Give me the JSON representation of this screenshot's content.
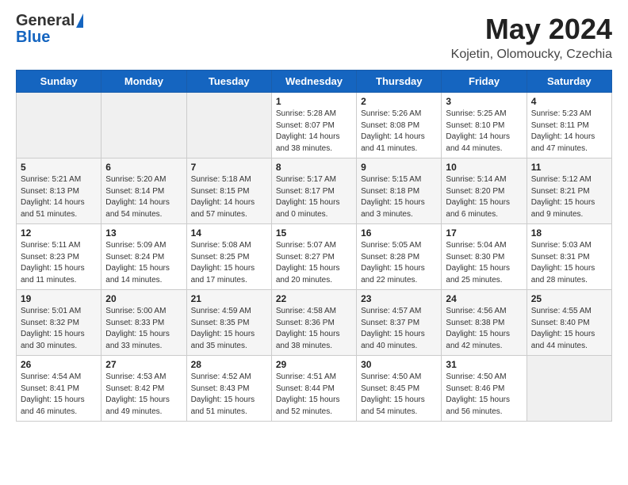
{
  "header": {
    "logo_general": "General",
    "logo_blue": "Blue",
    "month": "May 2024",
    "location": "Kojetin, Olomoucky, Czechia"
  },
  "weekdays": [
    "Sunday",
    "Monday",
    "Tuesday",
    "Wednesday",
    "Thursday",
    "Friday",
    "Saturday"
  ],
  "weeks": [
    [
      {
        "day": "",
        "info": ""
      },
      {
        "day": "",
        "info": ""
      },
      {
        "day": "",
        "info": ""
      },
      {
        "day": "1",
        "info": "Sunrise: 5:28 AM\nSunset: 8:07 PM\nDaylight: 14 hours\nand 38 minutes."
      },
      {
        "day": "2",
        "info": "Sunrise: 5:26 AM\nSunset: 8:08 PM\nDaylight: 14 hours\nand 41 minutes."
      },
      {
        "day": "3",
        "info": "Sunrise: 5:25 AM\nSunset: 8:10 PM\nDaylight: 14 hours\nand 44 minutes."
      },
      {
        "day": "4",
        "info": "Sunrise: 5:23 AM\nSunset: 8:11 PM\nDaylight: 14 hours\nand 47 minutes."
      }
    ],
    [
      {
        "day": "5",
        "info": "Sunrise: 5:21 AM\nSunset: 8:13 PM\nDaylight: 14 hours\nand 51 minutes."
      },
      {
        "day": "6",
        "info": "Sunrise: 5:20 AM\nSunset: 8:14 PM\nDaylight: 14 hours\nand 54 minutes."
      },
      {
        "day": "7",
        "info": "Sunrise: 5:18 AM\nSunset: 8:15 PM\nDaylight: 14 hours\nand 57 minutes."
      },
      {
        "day": "8",
        "info": "Sunrise: 5:17 AM\nSunset: 8:17 PM\nDaylight: 15 hours\nand 0 minutes."
      },
      {
        "day": "9",
        "info": "Sunrise: 5:15 AM\nSunset: 8:18 PM\nDaylight: 15 hours\nand 3 minutes."
      },
      {
        "day": "10",
        "info": "Sunrise: 5:14 AM\nSunset: 8:20 PM\nDaylight: 15 hours\nand 6 minutes."
      },
      {
        "day": "11",
        "info": "Sunrise: 5:12 AM\nSunset: 8:21 PM\nDaylight: 15 hours\nand 9 minutes."
      }
    ],
    [
      {
        "day": "12",
        "info": "Sunrise: 5:11 AM\nSunset: 8:23 PM\nDaylight: 15 hours\nand 11 minutes."
      },
      {
        "day": "13",
        "info": "Sunrise: 5:09 AM\nSunset: 8:24 PM\nDaylight: 15 hours\nand 14 minutes."
      },
      {
        "day": "14",
        "info": "Sunrise: 5:08 AM\nSunset: 8:25 PM\nDaylight: 15 hours\nand 17 minutes."
      },
      {
        "day": "15",
        "info": "Sunrise: 5:07 AM\nSunset: 8:27 PM\nDaylight: 15 hours\nand 20 minutes."
      },
      {
        "day": "16",
        "info": "Sunrise: 5:05 AM\nSunset: 8:28 PM\nDaylight: 15 hours\nand 22 minutes."
      },
      {
        "day": "17",
        "info": "Sunrise: 5:04 AM\nSunset: 8:30 PM\nDaylight: 15 hours\nand 25 minutes."
      },
      {
        "day": "18",
        "info": "Sunrise: 5:03 AM\nSunset: 8:31 PM\nDaylight: 15 hours\nand 28 minutes."
      }
    ],
    [
      {
        "day": "19",
        "info": "Sunrise: 5:01 AM\nSunset: 8:32 PM\nDaylight: 15 hours\nand 30 minutes."
      },
      {
        "day": "20",
        "info": "Sunrise: 5:00 AM\nSunset: 8:33 PM\nDaylight: 15 hours\nand 33 minutes."
      },
      {
        "day": "21",
        "info": "Sunrise: 4:59 AM\nSunset: 8:35 PM\nDaylight: 15 hours\nand 35 minutes."
      },
      {
        "day": "22",
        "info": "Sunrise: 4:58 AM\nSunset: 8:36 PM\nDaylight: 15 hours\nand 38 minutes."
      },
      {
        "day": "23",
        "info": "Sunrise: 4:57 AM\nSunset: 8:37 PM\nDaylight: 15 hours\nand 40 minutes."
      },
      {
        "day": "24",
        "info": "Sunrise: 4:56 AM\nSunset: 8:38 PM\nDaylight: 15 hours\nand 42 minutes."
      },
      {
        "day": "25",
        "info": "Sunrise: 4:55 AM\nSunset: 8:40 PM\nDaylight: 15 hours\nand 44 minutes."
      }
    ],
    [
      {
        "day": "26",
        "info": "Sunrise: 4:54 AM\nSunset: 8:41 PM\nDaylight: 15 hours\nand 46 minutes."
      },
      {
        "day": "27",
        "info": "Sunrise: 4:53 AM\nSunset: 8:42 PM\nDaylight: 15 hours\nand 49 minutes."
      },
      {
        "day": "28",
        "info": "Sunrise: 4:52 AM\nSunset: 8:43 PM\nDaylight: 15 hours\nand 51 minutes."
      },
      {
        "day": "29",
        "info": "Sunrise: 4:51 AM\nSunset: 8:44 PM\nDaylight: 15 hours\nand 52 minutes."
      },
      {
        "day": "30",
        "info": "Sunrise: 4:50 AM\nSunset: 8:45 PM\nDaylight: 15 hours\nand 54 minutes."
      },
      {
        "day": "31",
        "info": "Sunrise: 4:50 AM\nSunset: 8:46 PM\nDaylight: 15 hours\nand 56 minutes."
      },
      {
        "day": "",
        "info": ""
      }
    ]
  ]
}
